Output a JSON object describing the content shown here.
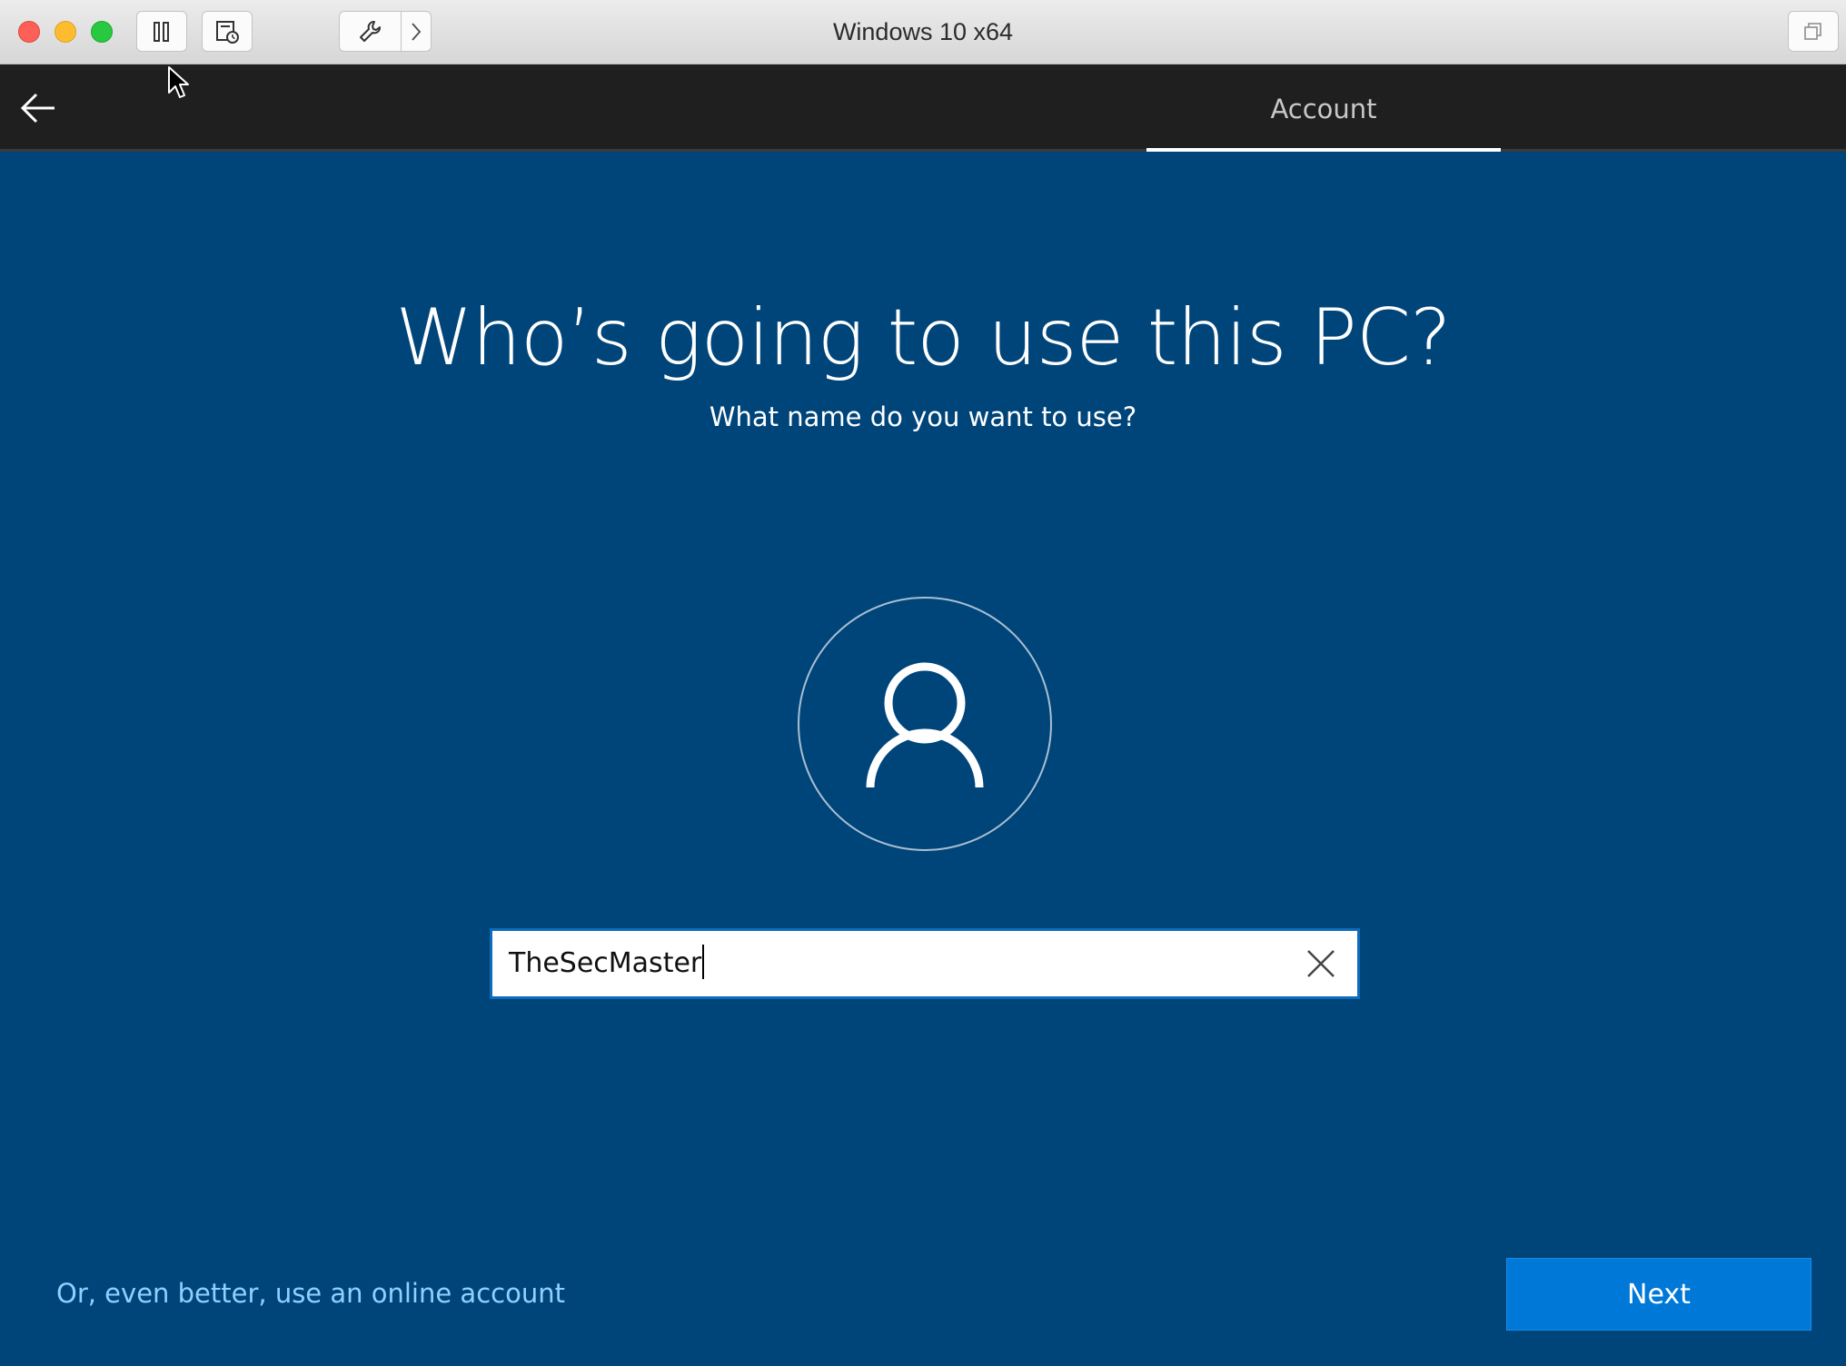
{
  "mac_window": {
    "title": "Windows 10 x64",
    "toolbar_icons": [
      "pause-icon",
      "snapshot-icon",
      "wrench-icon",
      "chevron-right-icon",
      "restore-window-icon"
    ]
  },
  "header": {
    "back_icon": "back-arrow-icon",
    "tab_label": "Account"
  },
  "page": {
    "title": "Who’s going to use this PC?",
    "subtitle": "What name do you want to use?",
    "avatar_icon": "user-icon"
  },
  "form": {
    "name_value": "TheSecMaster",
    "clear_icon": "close-icon"
  },
  "footer": {
    "online_account_link": "Or, even better, use an online account",
    "next_label": "Next"
  },
  "colors": {
    "background": "#00457a",
    "header": "#1f1f1f",
    "accent_button": "#0078d7",
    "link": "#8fd0ff"
  }
}
